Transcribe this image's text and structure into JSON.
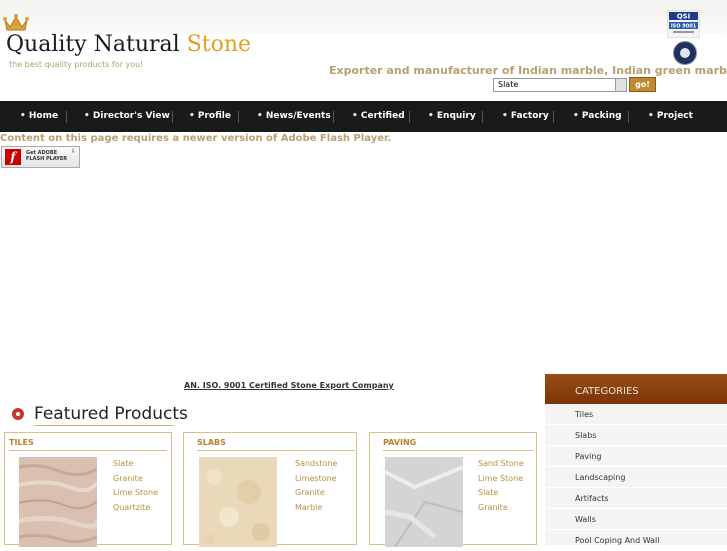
{
  "header": {
    "logo_main": "Quality Natural ",
    "logo_accent": "Stone",
    "tagline": "the best quality products for you!",
    "exporter_text": "Exporter and manufacturer of Indian marble, Indian green marble,",
    "cert_badge_top": "QSI",
    "cert_badge_bottom": "ISO 9001",
    "search": {
      "selected": "Slate",
      "go_label": "go!"
    }
  },
  "nav": {
    "items": [
      "Home",
      "Director's View",
      "Profile",
      "News/Events",
      "Certified",
      "Enquiry",
      "Factory",
      "Packing",
      "Project"
    ]
  },
  "flash": {
    "message": "Content on this page requires a newer version of Adobe Flash Player.",
    "badge_line1": "Get ADOBE",
    "badge_line2": "FLASH PLAYER"
  },
  "cert_link": "AN. ISO. 9001 Certified Stone Export Company",
  "featured": {
    "heading": "Featured Products",
    "cards": [
      {
        "title": "TILES",
        "links": [
          "Slate",
          "Granite",
          "Lime Stone",
          "Quartzite"
        ]
      },
      {
        "title": "SLABS",
        "links": [
          "Sandstone",
          "Limestone",
          "Granite",
          "Marble"
        ]
      },
      {
        "title": "PAVING",
        "links": [
          "Sand Stone",
          "Lime Stone",
          "Slate",
          "Granite"
        ]
      }
    ]
  },
  "categories": {
    "heading": "CATEGORIES",
    "items": [
      "Tiles",
      "Slabs",
      "Paving",
      "Landscaping",
      "Artifacts",
      "Walls",
      "Pool Coping And Wall"
    ]
  },
  "colors": {
    "accent": "#e0a020",
    "nav_bg": "#1a1a1a",
    "category_header": "#8a4010"
  }
}
